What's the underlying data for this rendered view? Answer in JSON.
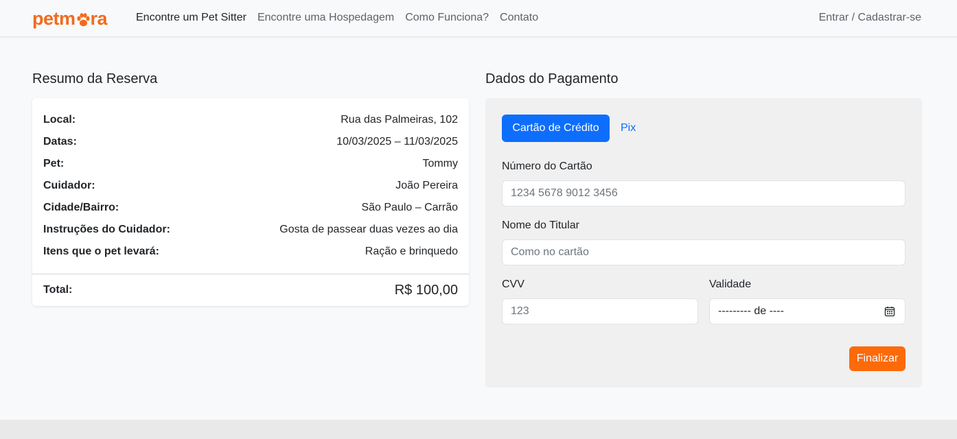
{
  "navbar": {
    "brand": {
      "prefix": "petm",
      "suffix": "ra",
      "color": "#f26b1d"
    },
    "links": [
      {
        "label": "Encontre um Pet Sitter",
        "active": true
      },
      {
        "label": "Encontre uma Hospedagem",
        "active": false
      },
      {
        "label": "Como Funciona?",
        "active": false
      },
      {
        "label": "Contato",
        "active": false
      }
    ],
    "account_label": "Entrar / Cadastrar-se"
  },
  "summary": {
    "title": "Resumo da Reserva",
    "rows": [
      {
        "label": "Local:",
        "value": "Rua das Palmeiras, 102"
      },
      {
        "label": "Datas:",
        "value": "10/03/2025 – 11/03/2025"
      },
      {
        "label": "Pet:",
        "value": "Tommy"
      },
      {
        "label": "Cuidador:",
        "value": "João Pereira"
      },
      {
        "label": "Cidade/Bairro:",
        "value": "São Paulo – Carrão"
      },
      {
        "label": "Instruções do Cuidador:",
        "value": "Gosta de passear duas vezes ao dia"
      },
      {
        "label": "Itens que o pet levará:",
        "value": "Ração e brinquedo"
      }
    ],
    "total_label": "Total:",
    "total_value": "R$ 100,00"
  },
  "payment": {
    "title": "Dados do Pagamento",
    "tabs": {
      "credit_card": "Cartão de Crédito",
      "pix": "Pix"
    },
    "card_number": {
      "label": "Número do Cartão",
      "placeholder": "1234 5678 9012 3456"
    },
    "holder_name": {
      "label": "Nome do Titular",
      "placeholder": "Como no cartão"
    },
    "cvv": {
      "label": "CVV",
      "placeholder": "123"
    },
    "expiry": {
      "label": "Validade",
      "value": "--------- de ----",
      "icon": "calendar-icon"
    },
    "submit_label": "Finalizar",
    "colors": {
      "primary": "#0d6efd",
      "accent": "#fd6a0a"
    }
  }
}
